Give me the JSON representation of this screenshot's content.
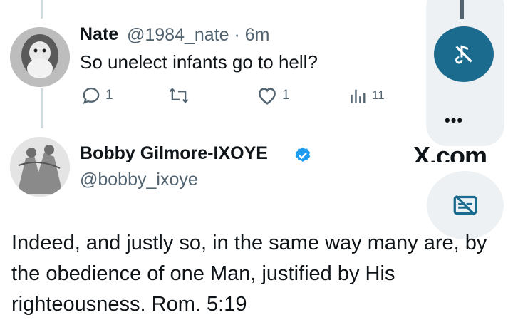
{
  "tweet1": {
    "author_name": "Nate",
    "handle_time": "@1984_nate · 6m",
    "text": "So unelect infants go to hell?",
    "replies": "1",
    "likes": "1",
    "views": "11"
  },
  "tweet2": {
    "author_name": "Bobby Gilmore-IXOYE",
    "handle": "@bobby_ixoye",
    "watermark": "X.com",
    "text": "Indeed, and justly so, in the same way many are, by the obedience of one Man, justified by His righteousness. Rom. 5:19"
  },
  "controls": {
    "more_label": "•••"
  },
  "colors": {
    "accent": "#1d9bf0",
    "mute_button": "#1b6b8f",
    "secondary_text": "#536471"
  },
  "icons": [
    "reply-icon",
    "retweet-icon",
    "like-icon",
    "views-icon",
    "verified-icon",
    "mute-icon",
    "more-icon",
    "captions-off-icon"
  ]
}
